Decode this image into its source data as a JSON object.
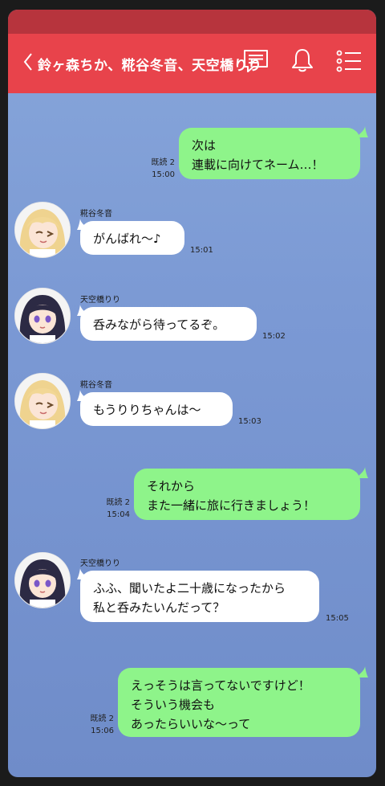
{
  "header": {
    "title": "鈴ヶ森ちか、糀谷冬音、天空橋りり"
  },
  "messages": [
    {
      "side": "right",
      "read": "既読 2",
      "time": "15:00",
      "lines": [
        "次は",
        "連載に向けてネーム…！"
      ]
    },
    {
      "side": "left",
      "sender": "糀谷冬音",
      "avatar": "blonde",
      "time": "15:01",
      "lines": [
        "がんばれ〜♪"
      ]
    },
    {
      "side": "left",
      "sender": "天空橋りり",
      "avatar": "dark",
      "time": "15:02",
      "lines": [
        "呑みながら待ってるぞ。"
      ]
    },
    {
      "side": "left",
      "sender": "糀谷冬音",
      "avatar": "blonde",
      "time": "15:03",
      "lines": [
        "もうりりちゃんは〜"
      ]
    },
    {
      "side": "right",
      "read": "既読 2",
      "time": "15:04",
      "lines": [
        "それから",
        "また一緒に旅に行きましょう！"
      ]
    },
    {
      "side": "left",
      "sender": "天空橋りり",
      "avatar": "dark",
      "time": "15:05",
      "lines": [
        "ふふ、聞いたよ二十歳になったから",
        "私と呑みたいんだって？"
      ]
    },
    {
      "side": "right",
      "read": "既読 2",
      "time": "15:06",
      "lines": [
        "えっそうは言ってないですけど！",
        "そういう機会も",
        "あったらいいな〜って"
      ]
    }
  ],
  "colors": {
    "header": "#e8434b",
    "header_strip": "#b7343d",
    "background_top": "#87a6da",
    "background_bottom": "#6f8cc9",
    "bubble_mine": "#8ef48a",
    "bubble_other": "#ffffff"
  },
  "icons": [
    "back-chevron-icon",
    "notes-icon",
    "bell-icon",
    "menu-list-icon"
  ]
}
